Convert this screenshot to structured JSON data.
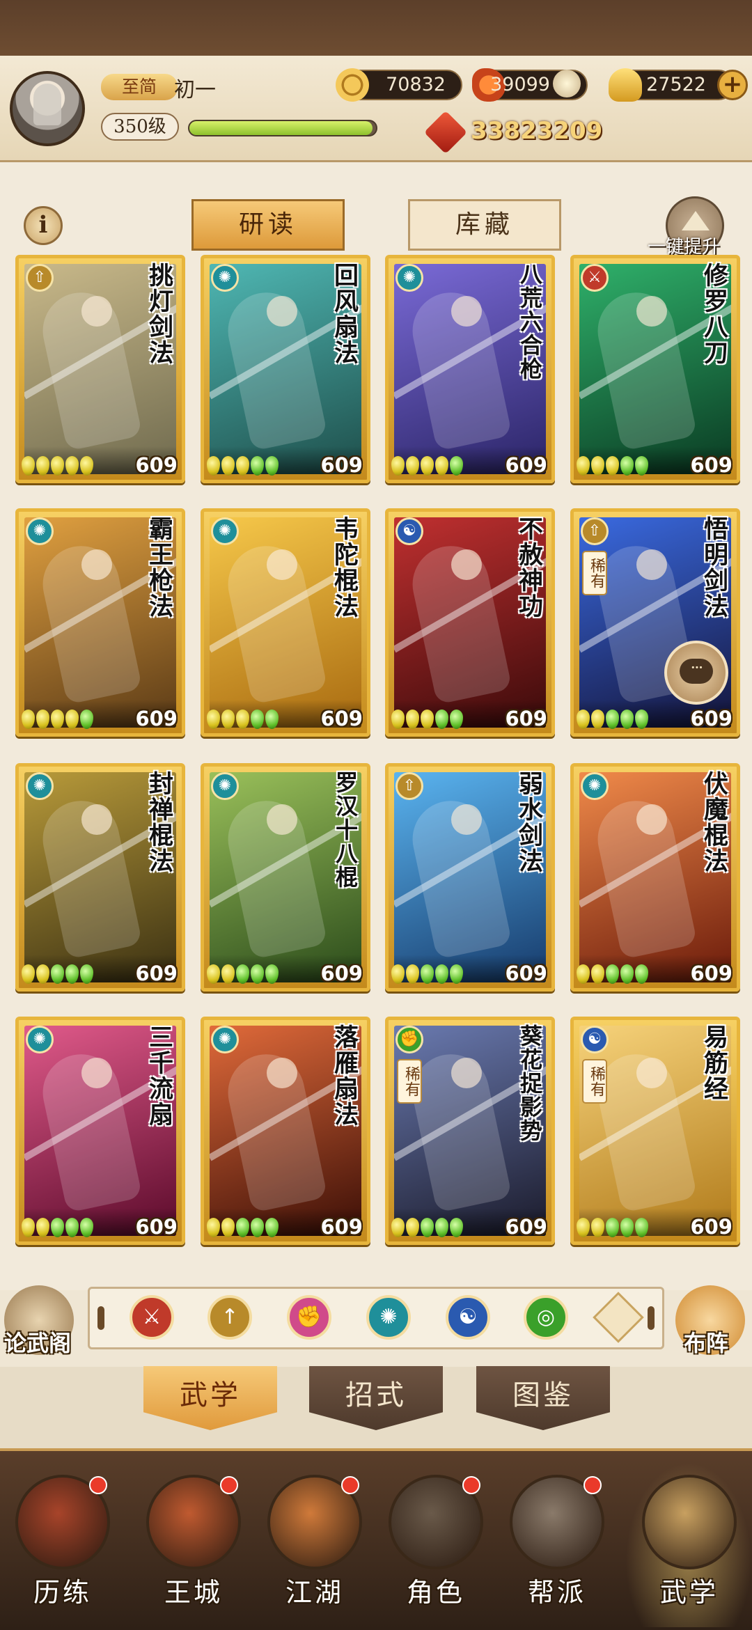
{
  "player": {
    "title": "至简",
    "name": "初一",
    "level": "350级",
    "xp_progress": 0.98,
    "power": "33823209"
  },
  "currencies": [
    {
      "icon": "coin-icon",
      "value": "70832"
    },
    {
      "icon": "flame-leaf-icon",
      "value": "39099"
    },
    {
      "icon": "gold-ingot-icon",
      "value": "27522"
    }
  ],
  "top_tabs": {
    "active": "研读",
    "inactive": "库藏"
  },
  "upgrade_all_label": "一键提升",
  "info_label": "i",
  "cards": [
    {
      "name": "挑灯剑法",
      "school": "dagger",
      "school_color": "#b88a2a",
      "level": "609",
      "rare": "",
      "beads": "yyyyy",
      "art": [
        "#c9b98a",
        "#6f6a4e"
      ]
    },
    {
      "name": "回风扇法",
      "school": "fan",
      "school_color": "#1f8f9a",
      "level": "609",
      "rare": "",
      "beads": "yyygg",
      "art": [
        "#4fb7b3",
        "#1e4e4a"
      ]
    },
    {
      "name": "八荒六合枪",
      "school": "fan",
      "school_color": "#1f8f9a",
      "level": "609",
      "rare": "",
      "beads": "yyyyg",
      "art": [
        "#7a6ad6",
        "#2a2466"
      ]
    },
    {
      "name": "修罗八刀",
      "school": "blade",
      "school_color": "#c03a2a",
      "level": "609",
      "rare": "",
      "beads": "yyygg",
      "art": [
        "#2fb06a",
        "#0a3a22"
      ]
    },
    {
      "name": "霸王枪法",
      "school": "fan",
      "school_color": "#1f8f9a",
      "level": "609",
      "rare": "",
      "beads": "yyyyg",
      "art": [
        "#e0a040",
        "#5a3a16"
      ]
    },
    {
      "name": "韦陀棍法",
      "school": "fan",
      "school_color": "#1f8f9a",
      "level": "609",
      "rare": "",
      "beads": "yyygg",
      "art": [
        "#f6c84a",
        "#a86a10"
      ]
    },
    {
      "name": "不赦神功",
      "school": "taiji",
      "school_color": "#2a5ab0",
      "level": "609",
      "rare": "",
      "beads": "yyygg",
      "art": [
        "#c03030",
        "#3a0a0a"
      ]
    },
    {
      "name": "悟明剑法",
      "school": "dagger",
      "school_color": "#b88a2a",
      "level": "609",
      "rare": "稀有",
      "beads": "yyggg",
      "art": [
        "#3a6ae0",
        "#14143a"
      ]
    },
    {
      "name": "封禅棍法",
      "school": "fan",
      "school_color": "#1f8f9a",
      "level": "609",
      "rare": "",
      "beads": "yyggg",
      "art": [
        "#b89a3a",
        "#3a3012"
      ]
    },
    {
      "name": "罗汉十八棍",
      "school": "fan",
      "school_color": "#1f8f9a",
      "level": "609",
      "rare": "",
      "beads": "yyggg",
      "art": [
        "#9ac05a",
        "#2a4a1a"
      ]
    },
    {
      "name": "弱水剑法",
      "school": "dagger",
      "school_color": "#b88a2a",
      "level": "609",
      "rare": "",
      "beads": "yyggg",
      "art": [
        "#5ab4f0",
        "#163a6a"
      ]
    },
    {
      "name": "伏魔棍法",
      "school": "fan",
      "school_color": "#1f8f9a",
      "level": "609",
      "rare": "",
      "beads": "yyggg",
      "art": [
        "#f08a4a",
        "#6a1a0a"
      ]
    },
    {
      "name": "三千流扇",
      "school": "fan",
      "school_color": "#1f8f9a",
      "level": "609",
      "rare": "",
      "beads": "yyggg",
      "art": [
        "#e05a8a",
        "#5a0a2a"
      ]
    },
    {
      "name": "落雁扇法",
      "school": "fan",
      "school_color": "#1f8f9a",
      "level": "609",
      "rare": "",
      "beads": "yyggg",
      "art": [
        "#e06a3a",
        "#3a0e06"
      ]
    },
    {
      "name": "葵花捉影势",
      "school": "fist",
      "school_color": "#3aa02a",
      "level": "609",
      "rare": "稀有",
      "beads": "yyggg",
      "art": [
        "#6a7ab0",
        "#1a1a2a"
      ]
    },
    {
      "name": "易筋经",
      "school": "taiji",
      "school_color": "#2a5ab0",
      "level": "609",
      "rare": "稀有",
      "beads": "yyggg",
      "art": [
        "#f6d27a",
        "#b07a1a"
      ]
    }
  ],
  "filter_icons": [
    {
      "name": "blade-school-icon",
      "glyph": "⚔",
      "color": "#c03a2a"
    },
    {
      "name": "dagger-school-icon",
      "glyph": "↑",
      "color": "#b88a2a"
    },
    {
      "name": "fist-school-icon",
      "glyph": "✊",
      "color": "#d04a8a"
    },
    {
      "name": "fan-school-icon",
      "glyph": "✺",
      "color": "#1f8f9a"
    },
    {
      "name": "taiji-school-icon",
      "glyph": "☯",
      "color": "#2a5ab0"
    },
    {
      "name": "green-school-icon",
      "glyph": "◎",
      "color": "#3aa02a"
    }
  ],
  "side_buttons": {
    "left": "论武阁",
    "right": "布阵"
  },
  "sub_tabs": [
    "武学",
    "招式",
    "图鉴"
  ],
  "nav": [
    {
      "label": "历练",
      "icon": "sword-scroll-icon",
      "dot": true,
      "bg": "#a8442a"
    },
    {
      "label": "王城",
      "icon": "palace-icon",
      "dot": true,
      "bg": "#c05a30"
    },
    {
      "label": "江湖",
      "icon": "swords-icon",
      "dot": true,
      "bg": "#d07a3a"
    },
    {
      "label": "角色",
      "icon": "hero-portrait-icon",
      "dot": true,
      "bg": "#6a5a4a"
    },
    {
      "label": "帮派",
      "icon": "guild-emblem-icon",
      "dot": true,
      "bg": "#8a7a6a"
    },
    {
      "label": "武学",
      "icon": "scrolls-icon",
      "dot": false,
      "bg": "#c8a060"
    }
  ]
}
